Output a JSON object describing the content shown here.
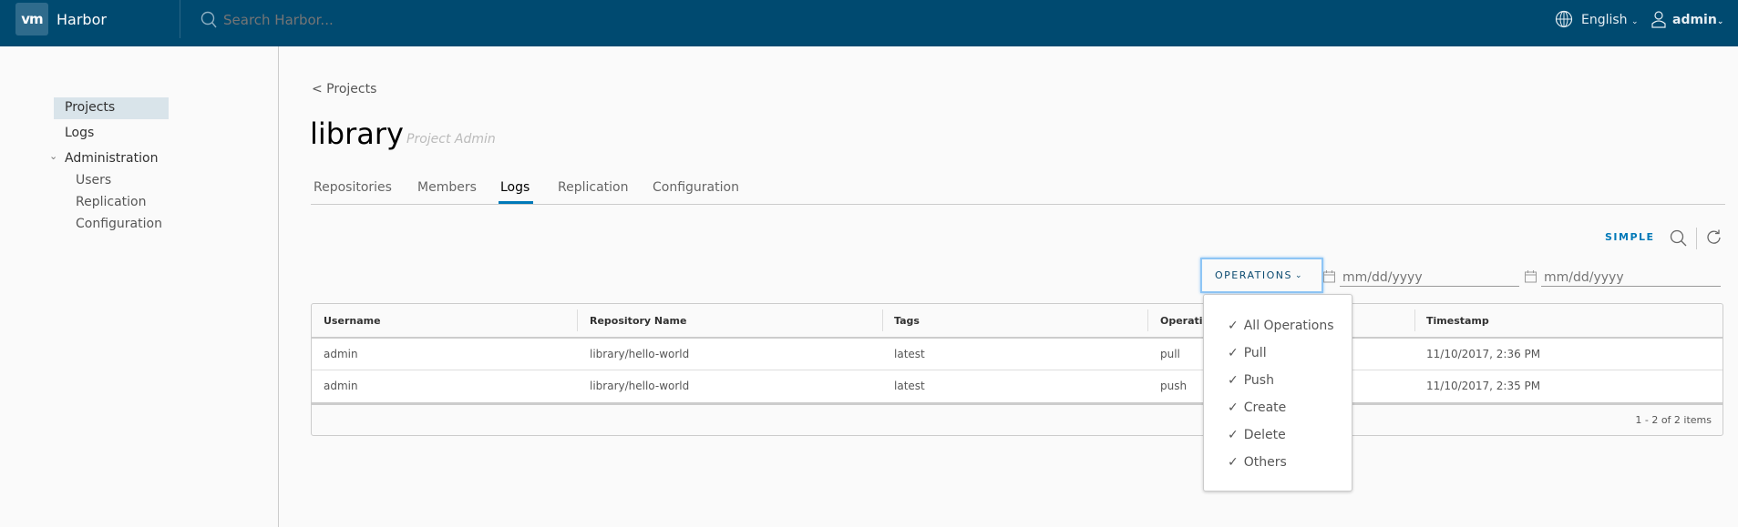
{
  "header": {
    "logo": "vm",
    "brand": "Harbor",
    "search_placeholder": "Search Harbor...",
    "language": "English",
    "user": "admin",
    "color": "#004a70"
  },
  "sidebar": {
    "items": [
      {
        "label": "Projects",
        "active": true
      },
      {
        "label": "Logs"
      },
      {
        "label": "Administration"
      }
    ],
    "admin_items": [
      "Users",
      "Replication",
      "Configuration"
    ]
  },
  "main": {
    "back": "< Projects",
    "title": "library",
    "role": "Project Admin",
    "tabs": [
      "Repositories",
      "Members",
      "Logs",
      "Replication",
      "Configuration"
    ],
    "active_tab": "Logs",
    "simple": "SIMPLE",
    "operations": "OPERATIONS",
    "date_placeholder": "mm/dd/yyyy",
    "menu": [
      "All Operations",
      "Pull",
      "Push",
      "Create",
      "Delete",
      "Others"
    ],
    "columns": [
      "Username",
      "Repository Name",
      "Tags",
      "Operation",
      "Timestamp"
    ],
    "rows": [
      [
        "admin",
        "library/hello-world",
        "latest",
        "pull",
        "11/10/2017, 2:36 PM"
      ],
      [
        "admin",
        "library/hello-world",
        "latest",
        "push",
        "11/10/2017, 2:35 PM"
      ]
    ],
    "footer": "1 - 2 of 2 items",
    "accent": "#0079b8"
  }
}
